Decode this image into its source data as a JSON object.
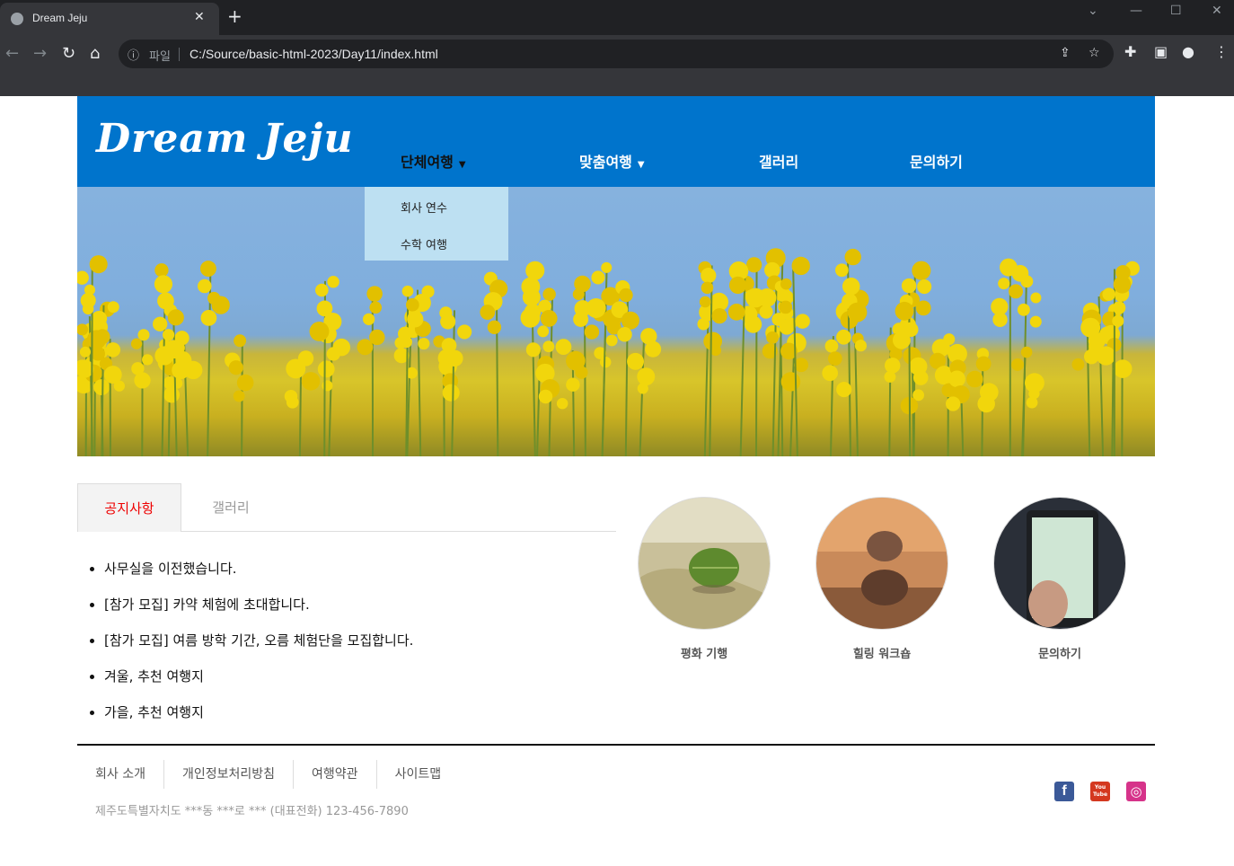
{
  "browser": {
    "tab_title": "Dream Jeju",
    "tab_close": "✕",
    "new_tab": "+",
    "site_label": "파일",
    "url": "C:/Source/basic-html-2023/Day11/index.html"
  },
  "site": {
    "logo": "Dream Jeju",
    "menu": [
      {
        "label": "단체여행",
        "caret": "▼"
      },
      {
        "label": "맞춤여행",
        "caret": "▼"
      },
      {
        "label": "갤러리"
      },
      {
        "label": "문의하기"
      }
    ],
    "dropdown": [
      "회사 연수",
      "수학 여행"
    ]
  },
  "tabs": {
    "active": "공지사항",
    "inactive": "갤러리"
  },
  "notices": [
    "사무실을 이전했습니다.",
    "[참가 모집] 카약 체험에 초대합니다.",
    "[참가 모집] 여름 방학 기간, 오름 체험단을 모집합니다.",
    "겨울, 추천 여행지",
    "가을, 추천 여행지"
  ],
  "circles": [
    {
      "caption": "평화 기행"
    },
    {
      "caption": "힐링 워크숍"
    },
    {
      "caption": "문의하기"
    }
  ],
  "footer": {
    "links": [
      "회사 소개",
      "개인정보처리방침",
      "여행약관",
      "사이트맵"
    ],
    "address": "제주도특별자치도 ***동 ***로 *** (대표전화) 123-456-7890"
  },
  "social": {
    "facebook": "f",
    "youtube": "You Tube",
    "instagram": "◎"
  },
  "colors": {
    "header": "#0074cc",
    "dropdown": "#bde0f2",
    "active_tab_text": "#ee0000"
  }
}
